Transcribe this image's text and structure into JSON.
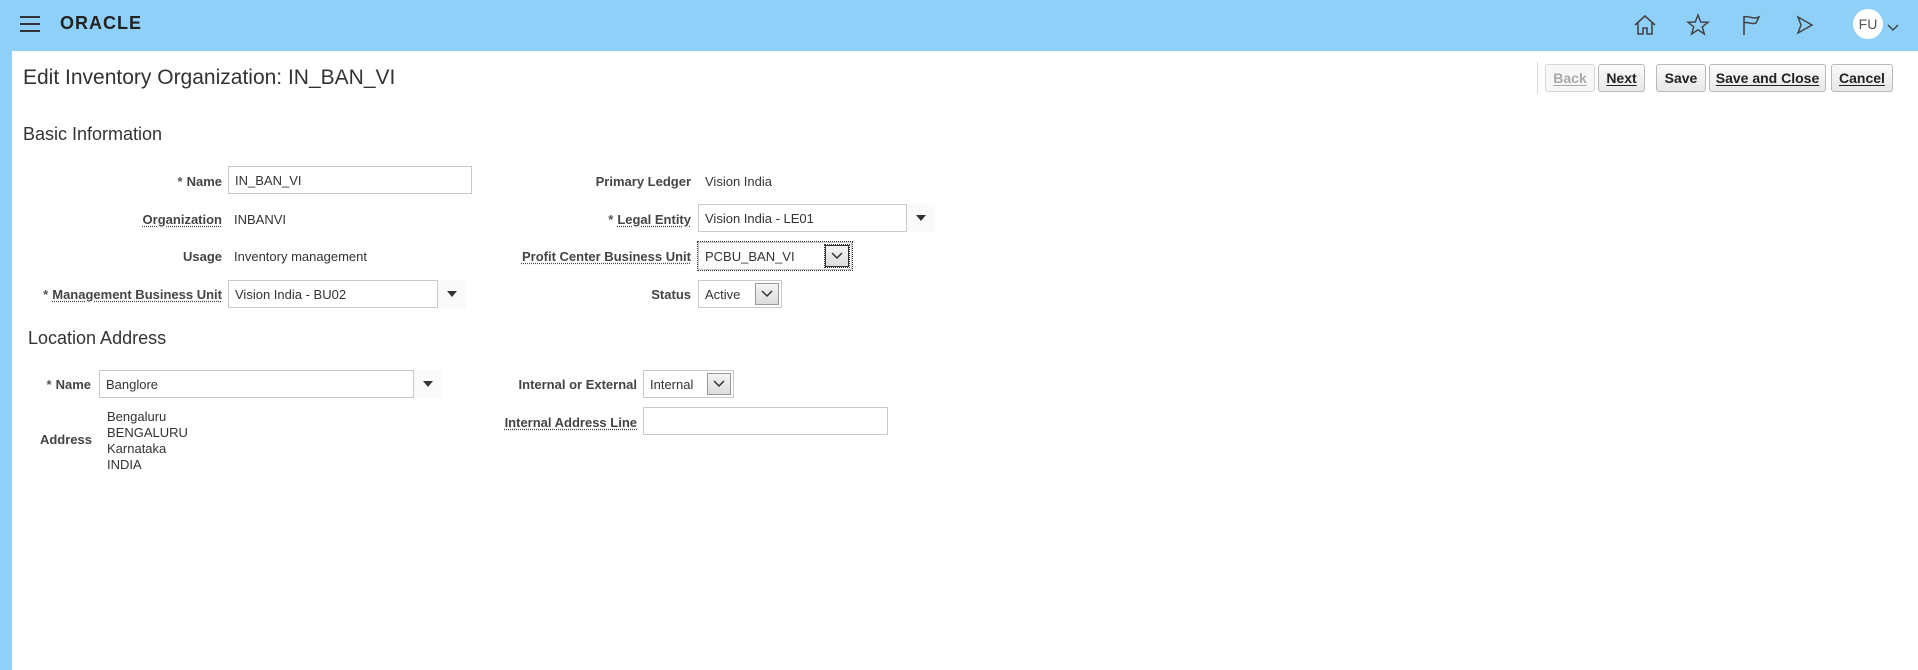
{
  "header": {
    "logo": "ORACLE",
    "icons": [
      "menu-icon",
      "home-icon",
      "star-icon",
      "flag-icon",
      "bell-icon"
    ],
    "user_initials": "FU"
  },
  "page": {
    "title": "Edit Inventory Organization: IN_BAN_VI"
  },
  "buttons": {
    "back": "Back",
    "next": "Next",
    "save": "Save",
    "save_close": "Save and Close",
    "cancel": "Cancel"
  },
  "basic": {
    "heading": "Basic Information",
    "name_label": "Name",
    "name_value": "IN_BAN_VI",
    "organization_label": "Organization",
    "organization_value": "INBANVI",
    "usage_label": "Usage",
    "usage_value": "Inventory management",
    "mbu_label": "Management Business Unit",
    "mbu_value": "Vision India - BU02",
    "primary_ledger_label": "Primary Ledger",
    "primary_ledger_value": "Vision India",
    "legal_entity_label": "Legal Entity",
    "legal_entity_value": "Vision India - LE01",
    "pcbu_label": "Profit Center Business Unit",
    "pcbu_value": "PCBU_BAN_VI",
    "status_label": "Status",
    "status_value": "Active"
  },
  "location": {
    "heading": "Location Address",
    "name_label": "Name",
    "name_value": "Banglore",
    "address_label": "Address",
    "address_lines": [
      "Bengaluru",
      "BENGALURU",
      "Karnataka",
      "INDIA"
    ],
    "int_ext_label": "Internal or External",
    "int_ext_value": "Internal",
    "internal_address_label": "Internal Address Line",
    "internal_address_value": ""
  },
  "colors": {
    "topbar": "#8ed0f8",
    "panel": "#ffffff"
  }
}
